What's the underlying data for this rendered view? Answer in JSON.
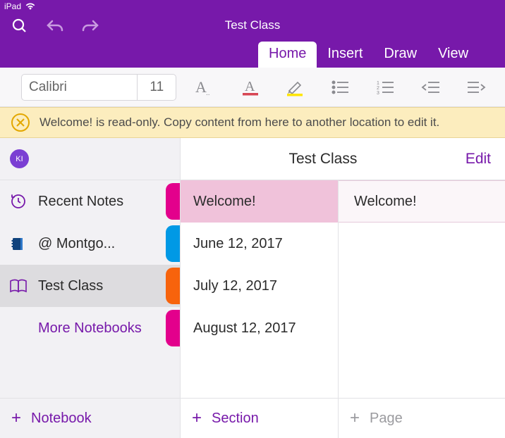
{
  "status": {
    "device": "iPad"
  },
  "doc_title": "Test Class",
  "tabs": {
    "home": "Home",
    "insert": "Insert",
    "draw": "Draw",
    "view": "View"
  },
  "ribbon": {
    "font_name": "Calibri",
    "font_size": "11"
  },
  "banner": {
    "text": "Welcome! is read-only. Copy content from here to another location to edit it."
  },
  "header": {
    "avatar_initials": "KI",
    "title": "Test Class",
    "edit": "Edit"
  },
  "notebook_col": {
    "recent": "Recent Notes",
    "item1": "@ Montgo...",
    "item2": "Test Class",
    "more": "More Notebooks"
  },
  "section_col": {
    "s0": "Welcome!",
    "s1": "June 12, 2017",
    "s2": "July 12, 2017",
    "s3": "August 12, 2017"
  },
  "page_col": {
    "p0": "Welcome!"
  },
  "add": {
    "notebook": "Notebook",
    "section": "Section",
    "page": "Page"
  },
  "colors": {
    "stripe_recent": "#E3008C",
    "stripe_item1": "#0099E5",
    "stripe_item2": "#F7630C",
    "stripe_more": "#E3008C"
  }
}
